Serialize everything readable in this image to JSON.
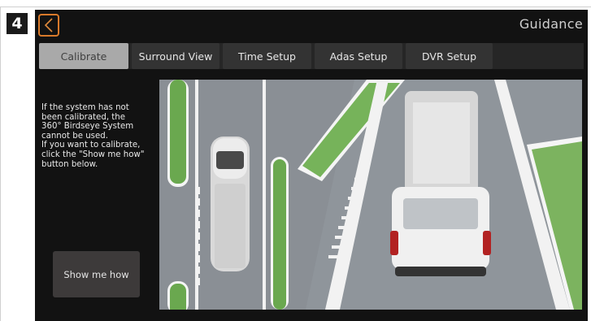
{
  "step_number": "4",
  "header": {
    "title": "Guidance",
    "back_icon": "chevron-left-icon"
  },
  "tabs": [
    {
      "label": "Calibrate",
      "active": true
    },
    {
      "label": "Surround View",
      "active": false
    },
    {
      "label": "Time Setup",
      "active": false
    },
    {
      "label": "Adas Setup",
      "active": false
    },
    {
      "label": "DVR Setup",
      "active": false
    }
  ],
  "info": {
    "lines": [
      "If the system has not",
      "been calibrated, the",
      "360° Birdseye System",
      "cannot be used.",
      "If you want to calibrate,",
      "click the \"Show me how\"",
      "button below."
    ]
  },
  "show_me_how_label": "Show me how",
  "colors": {
    "accent": "#d97a2b",
    "screen_bg": "#121212",
    "tab_active": "#a9a9a9",
    "tab_inactive": "#333333"
  }
}
